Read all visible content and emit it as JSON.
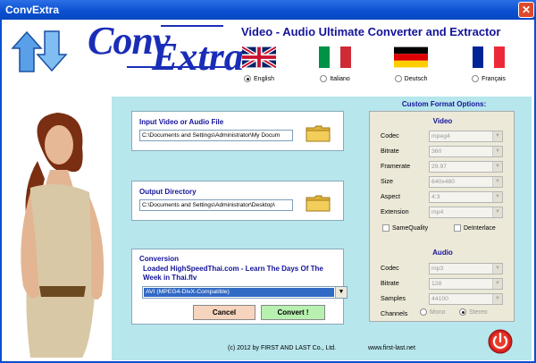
{
  "window": {
    "title": "ConvExtra"
  },
  "logo": {
    "part1": "Conv",
    "part2": "Extra"
  },
  "heading": "Video - Audio Ultimate Converter and Extractor",
  "languages": [
    {
      "label": "English",
      "selected": true
    },
    {
      "label": "Italiano",
      "selected": false
    },
    {
      "label": "Deutsch",
      "selected": false
    },
    {
      "label": "Français",
      "selected": false
    }
  ],
  "input": {
    "title": "Input Video or Audio File",
    "value": "C:\\Documents and Settings\\Administrator\\My Docum"
  },
  "output": {
    "title": "Output Directory",
    "value": "C:\\Documents and Settings\\Administrator\\Desktop\\"
  },
  "conversion": {
    "title": "Conversion",
    "status": "Loaded HighSpeedThai.com - Learn The Days Of The Week in Thai.flv",
    "format": "AVI (MPEG4-DivX-Compatible)",
    "cancel_label": "Cancel",
    "convert_label": "Convert !"
  },
  "custom": {
    "title": "Custom Format Options:",
    "video_head": "Video",
    "video_fields": [
      {
        "label": "Codec",
        "value": "mpeg4"
      },
      {
        "label": "Bitrate",
        "value": "360"
      },
      {
        "label": "Framerate",
        "value": "29.97"
      },
      {
        "label": "Size",
        "value": "640x480"
      },
      {
        "label": "Aspect",
        "value": "4:3"
      },
      {
        "label": "Extension",
        "value": "mp4"
      }
    ],
    "same_quality": "SameQuality",
    "deinterlace": "DeInterlace",
    "audio_head": "Audio",
    "audio_fields": [
      {
        "label": "Codec",
        "value": "mp3"
      },
      {
        "label": "Bitrate",
        "value": "128"
      },
      {
        "label": "Samples",
        "value": "44100"
      }
    ],
    "channels_label": "Channels",
    "mono": "Mono",
    "stereo": "Stereo"
  },
  "footer": {
    "copyright": "(c) 2012 by FIRST AND LAST Co., Ltd.",
    "url": "www.first-last.net"
  },
  "colors": {
    "titlebar": "#0a4fd0",
    "panel": "#b7e6ed",
    "heading": "#14149a",
    "cancel": "#f6d4bd",
    "convert": "#b8f0b0"
  }
}
